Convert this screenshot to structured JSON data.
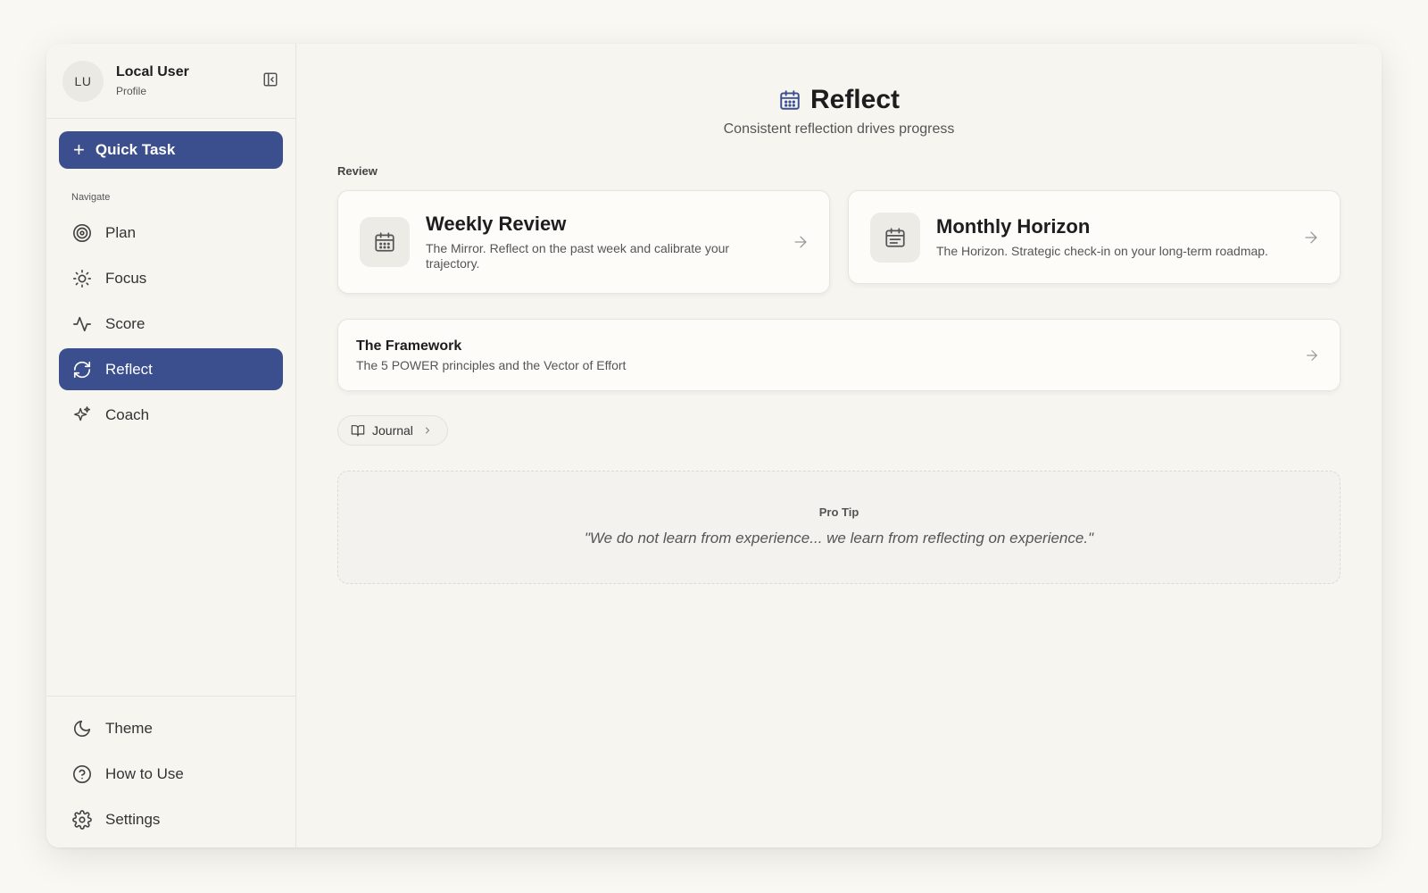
{
  "profile": {
    "initials": "LU",
    "name": "Local User",
    "subtitle": "Profile"
  },
  "sidebar": {
    "quick_task_label": "Quick Task",
    "nav_label": "Navigate",
    "items": [
      {
        "label": "Plan",
        "icon": "target-icon",
        "active": false
      },
      {
        "label": "Focus",
        "icon": "sun-icon",
        "active": false
      },
      {
        "label": "Score",
        "icon": "activity-icon",
        "active": false
      },
      {
        "label": "Reflect",
        "icon": "refresh-icon",
        "active": true
      },
      {
        "label": "Coach",
        "icon": "sparkles-icon",
        "active": false
      }
    ],
    "bottom_items": [
      {
        "label": "Theme",
        "icon": "moon-icon"
      },
      {
        "label": "How to Use",
        "icon": "help-circle-icon"
      },
      {
        "label": "Settings",
        "icon": "gear-icon"
      }
    ]
  },
  "header": {
    "title": "Reflect",
    "subtitle": "Consistent reflection drives progress"
  },
  "review": {
    "label": "Review",
    "cards": [
      {
        "title": "Weekly Review",
        "description": "The Mirror. Reflect on the past week and calibrate your trajectory."
      },
      {
        "title": "Monthly Horizon",
        "description": "The Horizon. Strategic check-in on your long-term roadmap."
      }
    ]
  },
  "framework": {
    "title": "The Framework",
    "description": "The 5 POWER principles and the Vector of Effort"
  },
  "journal": {
    "label": "Journal"
  },
  "tip": {
    "title": "Pro Tip",
    "quote": "\"We do not learn from experience... we learn from reflecting on experience.\""
  },
  "colors": {
    "accent": "#3b4f8e",
    "background": "#f6f5f0",
    "page": "#faf8f3"
  }
}
